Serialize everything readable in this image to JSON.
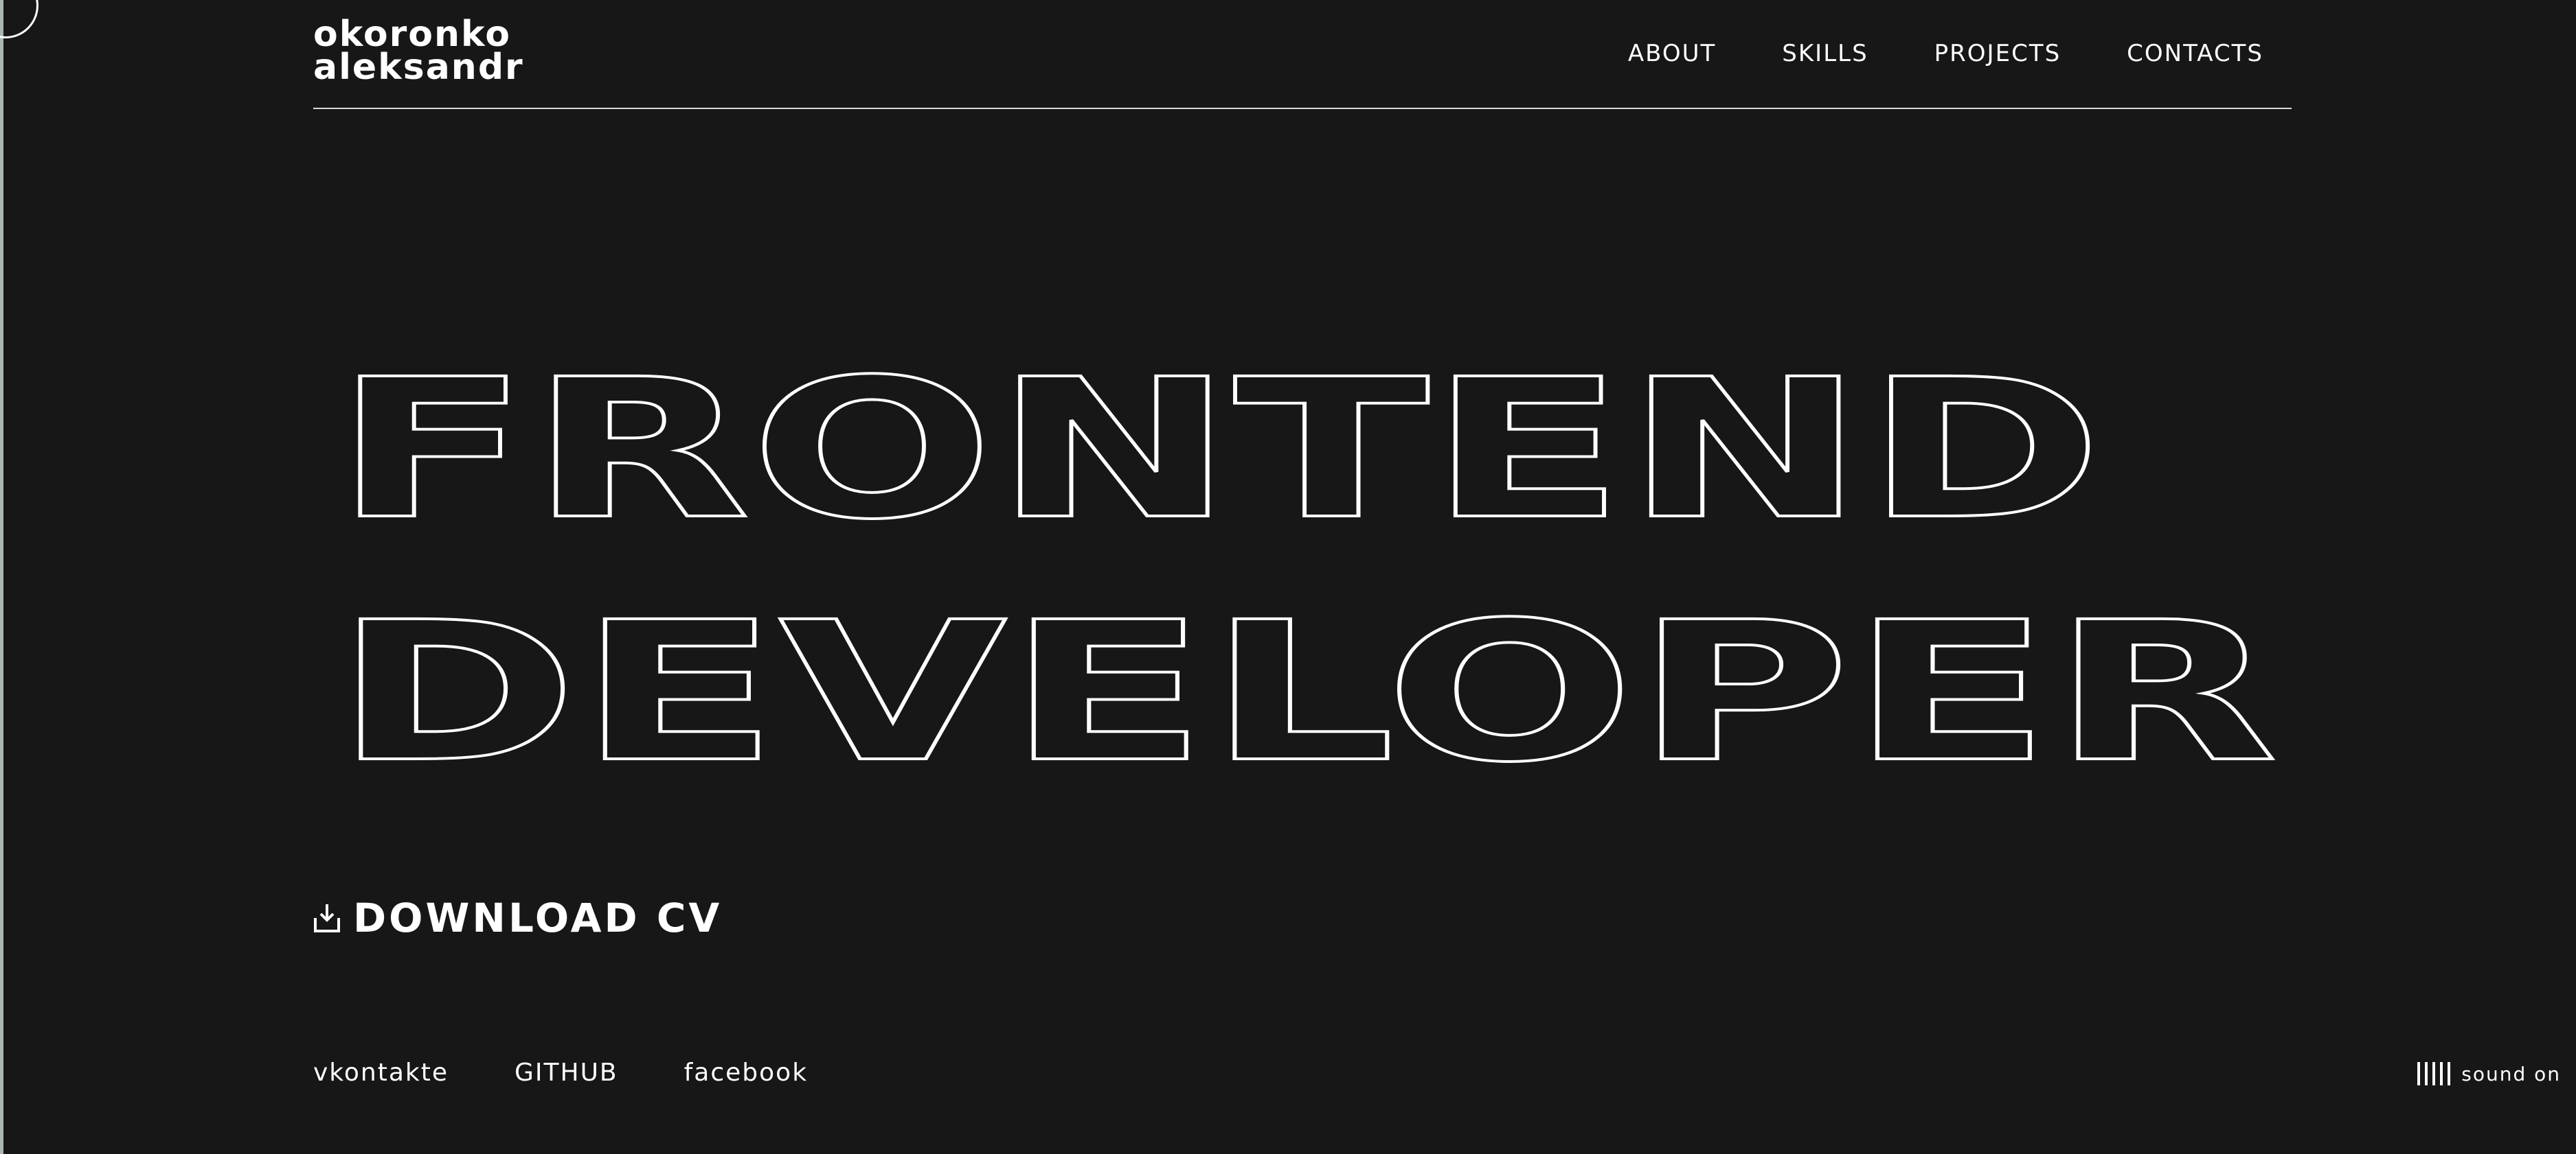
{
  "logo": {
    "line1": "okoronko",
    "line2": "aleksandr"
  },
  "nav": {
    "about": "ABOUT",
    "skills": "SKILLS",
    "projects": "PROJECTS",
    "contacts": "CONTACTS"
  },
  "hero": {
    "line1": "FRONTEND",
    "line2": "DEVELOPER"
  },
  "download": {
    "label": "download cv",
    "icon": "download-icon"
  },
  "socials": {
    "vk": "vkontakte",
    "github": "GITHUB",
    "facebook": "facebook"
  },
  "sound": {
    "label": "sound on",
    "icon": "sound-bars-icon"
  },
  "colors": {
    "background": "#171717",
    "foreground": "#ffffff",
    "edge": "#a8b7b1"
  }
}
